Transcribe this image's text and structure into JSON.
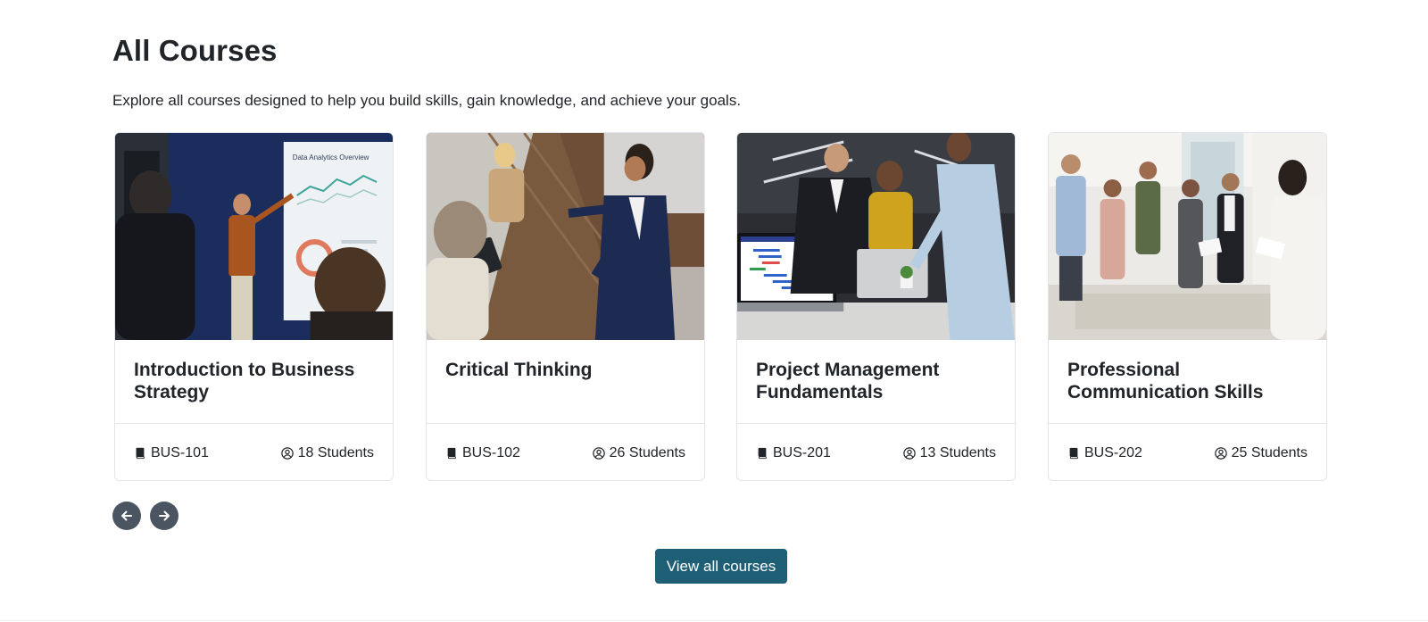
{
  "header": {
    "title": "All Courses",
    "subtitle": "Explore all courses designed to help you build skills, gain knowledge, and achieve your goals."
  },
  "courses": [
    {
      "title": "Introduction to Business Strategy",
      "code": "BUS-101",
      "students": "18 Students",
      "image": "presenter-pointing-at-data-analytics-chart",
      "image_caption": "Data Analytics Overview"
    },
    {
      "title": "Critical Thinking",
      "code": "BUS-102",
      "students": "26 Students",
      "image": "businessman-discussing-with-colleagues-overhead-view"
    },
    {
      "title": "Project Management Fundamentals",
      "code": "BUS-201",
      "students": "13 Students",
      "image": "team-reviewing-gantt-chart-on-laptop"
    },
    {
      "title": "Professional Communication Skills",
      "code": "BUS-202",
      "students": "25 Students",
      "image": "group-of-professionals-standing-in-meeting-room"
    }
  ],
  "carousel": {
    "prev_icon": "arrow-left-icon",
    "next_icon": "arrow-right-icon"
  },
  "actions": {
    "view_all_label": "View all courses"
  },
  "icons": {
    "course_code": "book-icon",
    "students": "user-circle-icon"
  },
  "colors": {
    "primary_button": "#1f5f76",
    "carousel_button": "#4a5561",
    "text": "#212529",
    "card_border": "#e3e6ea"
  }
}
